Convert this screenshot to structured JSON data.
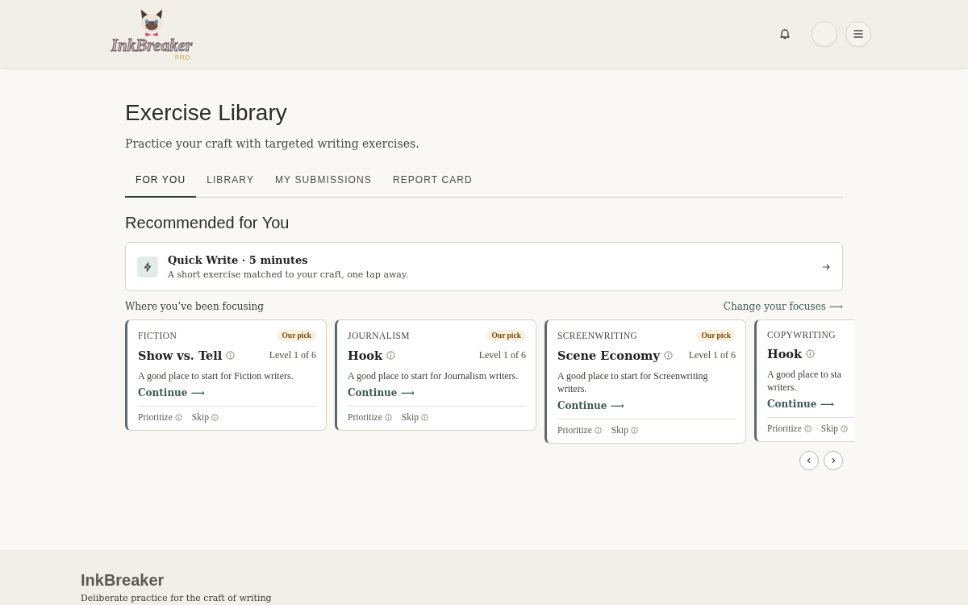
{
  "header": {
    "logo_text": "InkBreaker",
    "logo_badge": "PRO"
  },
  "page": {
    "title": "Exercise Library",
    "subtitle": "Practice your craft with targeted writing exercises."
  },
  "tabs": [
    {
      "label": "FOR YOU",
      "selected": true
    },
    {
      "label": "LIBRARY",
      "selected": false
    },
    {
      "label": "MY SUBMISSIONS",
      "selected": false
    },
    {
      "label": "REPORT CARD",
      "selected": false
    }
  ],
  "section_title": "Recommended for You",
  "quick_write": {
    "title": "Quick Write · 5 minutes",
    "description": "A short exercise matched to your craft, one tap away."
  },
  "focus": {
    "label": "Where you’ve been focusing",
    "link": "Change your focuses ⟶"
  },
  "cards": [
    {
      "category": "FICTION",
      "badge": "Our pick",
      "title": "Show vs. Tell",
      "level": "Level 1 of 6",
      "description": "A good place to start for Fiction writers.",
      "action": "Continue ⟶",
      "prioritize": "Prioritize",
      "skip": "Skip"
    },
    {
      "category": "JOURNALISM",
      "badge": "Our pick",
      "title": "Hook",
      "level": "Level 1 of 6",
      "description": "A good place to start for Journalism writers.",
      "action": "Continue ⟶",
      "prioritize": "Prioritize",
      "skip": "Skip"
    },
    {
      "category": "SCREENWRITING",
      "badge": "Our pick",
      "title": "Scene Economy",
      "level": "Level 1 of 6",
      "description": "A good place to start for Screenwriting writers.",
      "action": "Continue ⟶",
      "prioritize": "Prioritize",
      "skip": "Skip"
    },
    {
      "category": "COPYWRITING",
      "title": "Hook",
      "description": "A good place to sta\nwriters.",
      "action": "Continue ⟶",
      "prioritize": "Prioritize",
      "skip": "Skip"
    }
  ],
  "footer": {
    "brand": "InkBreaker",
    "tagline": "Deliberate practice for the craft of writing"
  }
}
